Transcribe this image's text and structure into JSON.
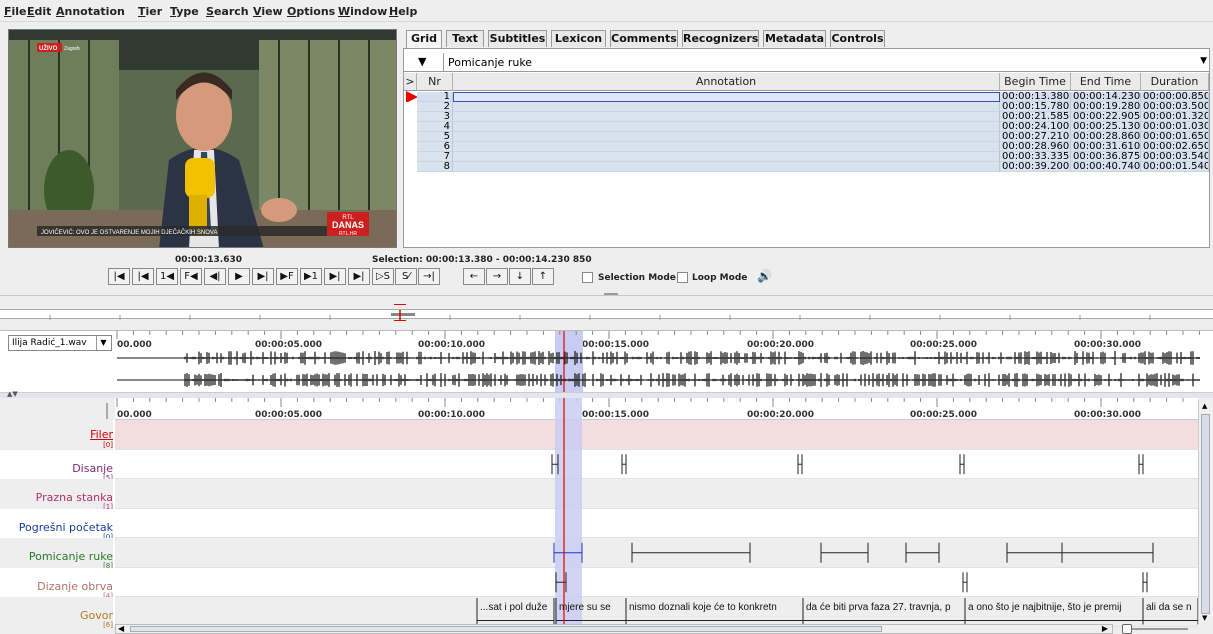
{
  "menu": [
    {
      "label": "File",
      "u": "F",
      "rest": "ile"
    },
    {
      "label": "Edit",
      "u": "E",
      "rest": "dit"
    },
    {
      "label": "Annotation",
      "u": "A",
      "rest": "nnotation"
    },
    {
      "label": "Tier",
      "u": "T",
      "rest": "ier"
    },
    {
      "label": "Type",
      "u": "T",
      "rest": "ype"
    },
    {
      "label": "Search",
      "u": "S",
      "rest": "earch"
    },
    {
      "label": "View",
      "u": "V",
      "rest": "iew"
    },
    {
      "label": "Options",
      "u": "O",
      "rest": "ptions"
    },
    {
      "label": "Window",
      "u": "W",
      "rest": "indow"
    },
    {
      "label": "Help",
      "u": "H",
      "rest": "elp"
    }
  ],
  "video": {
    "live_badge": "UŽIVO",
    "live_location": "Zagreb",
    "caption": "JOVIČEVIĆ: OVO JE OSTVARENJE MOJIH DJEČAČKIH SNOVA",
    "channel_logo_top": "RTL",
    "channel_logo": "DANAS",
    "channel_site": "RTL.HR"
  },
  "tabs": [
    "Grid",
    "Text",
    "Subtitles",
    "Lexicon",
    "Comments",
    "Recognizers",
    "Metadata",
    "Controls"
  ],
  "active_tab": "Grid",
  "grid": {
    "tier": "Pomicanje ruke",
    "columns": [
      ">",
      "Nr",
      "Annotation",
      "Begin Time",
      "End Time",
      "Duration"
    ],
    "rows": [
      {
        "nr": "1",
        "annotation": "",
        "begin": "00:00:13.380",
        "end": "00:00:14.230",
        "duration": "00:00:00.850"
      },
      {
        "nr": "2",
        "annotation": "",
        "begin": "00:00:15.780",
        "end": "00:00:19.280",
        "duration": "00:00:03.500"
      },
      {
        "nr": "3",
        "annotation": "",
        "begin": "00:00:21.585",
        "end": "00:00:22.905",
        "duration": "00:00:01.320"
      },
      {
        "nr": "4",
        "annotation": "",
        "begin": "00:00:24.100",
        "end": "00:00:25.130",
        "duration": "00:00:01.030"
      },
      {
        "nr": "5",
        "annotation": "",
        "begin": "00:00:27.210",
        "end": "00:00:28.860",
        "duration": "00:00:01.650"
      },
      {
        "nr": "6",
        "annotation": "",
        "begin": "00:00:28.960",
        "end": "00:00:31.610",
        "duration": "00:00:02.650"
      },
      {
        "nr": "7",
        "annotation": "",
        "begin": "00:00:33.335",
        "end": "00:00:36.875",
        "duration": "00:00:03.540"
      },
      {
        "nr": "8",
        "annotation": "",
        "begin": "00:00:39.200",
        "end": "00:00:40.740",
        "duration": "00:00:01.540"
      }
    ]
  },
  "media": {
    "current_time": "00:00:13.630",
    "selection_text": "Selection: 00:00:13.380 - 00:00:14.230  850",
    "selection_mode": "Selection Mode",
    "loop_mode": "Loop Mode",
    "buttons": [
      "|◀",
      "|◀",
      "1◀",
      "F◀",
      "◀|",
      "▶",
      "▶|",
      "▶F",
      "▶1",
      "▶|",
      "▶|"
    ],
    "sel_buttons": [
      "▷S",
      "S⁄",
      "→|"
    ],
    "nav_buttons": [
      "←",
      "→",
      "↓",
      "↑"
    ]
  },
  "wave": {
    "file": "Ilija Radić_1.wav",
    "ticks": [
      "00.000",
      "00:00:05.000",
      "00:00:10.000",
      "00:00:15.000",
      "00:00:20.000",
      "00:00:25.000",
      "00:00:30.000"
    ]
  },
  "timeline": {
    "ticks": [
      "00.000",
      "00:00:05.000",
      "00:00:10.000",
      "00:00:15.000",
      "00:00:20.000",
      "00:00:25.000",
      "00:00:30.000"
    ],
    "tiers": [
      {
        "name": "Filer",
        "count": "[0]",
        "color": "#cc0000",
        "bg": "#f3dede",
        "underline": true
      },
      {
        "name": "Disanje",
        "count": "[5]",
        "color": "#7a2a7a",
        "bg": "#ffffff"
      },
      {
        "name": "Prazna stanka",
        "count": "[1]",
        "color": "#b0306a",
        "bg": "#eeeeee"
      },
      {
        "name": "Pogrešni početak",
        "count": "[0]",
        "color": "#1a3aa0",
        "bg": "#ffffff"
      },
      {
        "name": "Pomicanje ruke",
        "count": "[8]",
        "color": "#2a7a2a",
        "bg": "#eeeeee"
      },
      {
        "name": "Dizanje obrva",
        "count": "[4]",
        "color": "#b07070",
        "bg": "#ffffff"
      },
      {
        "name": "Govor",
        "count": "[6]",
        "color": "#b07a20",
        "bg": "#eeeeee"
      }
    ],
    "govor_segments": [
      "...sat i pol duže",
      "mjere su se",
      "nismo doznali koje će to konkretn",
      "da će biti prva faza 27. travnja, p",
      "a ono što je najbitnije, što je premij",
      "ali da se n"
    ]
  },
  "colors": {
    "selection": "#c9ccf2",
    "crosshair": "#e00000",
    "grid_highlight": "#d2dcf0",
    "accent_blue": "#2233cc"
  }
}
